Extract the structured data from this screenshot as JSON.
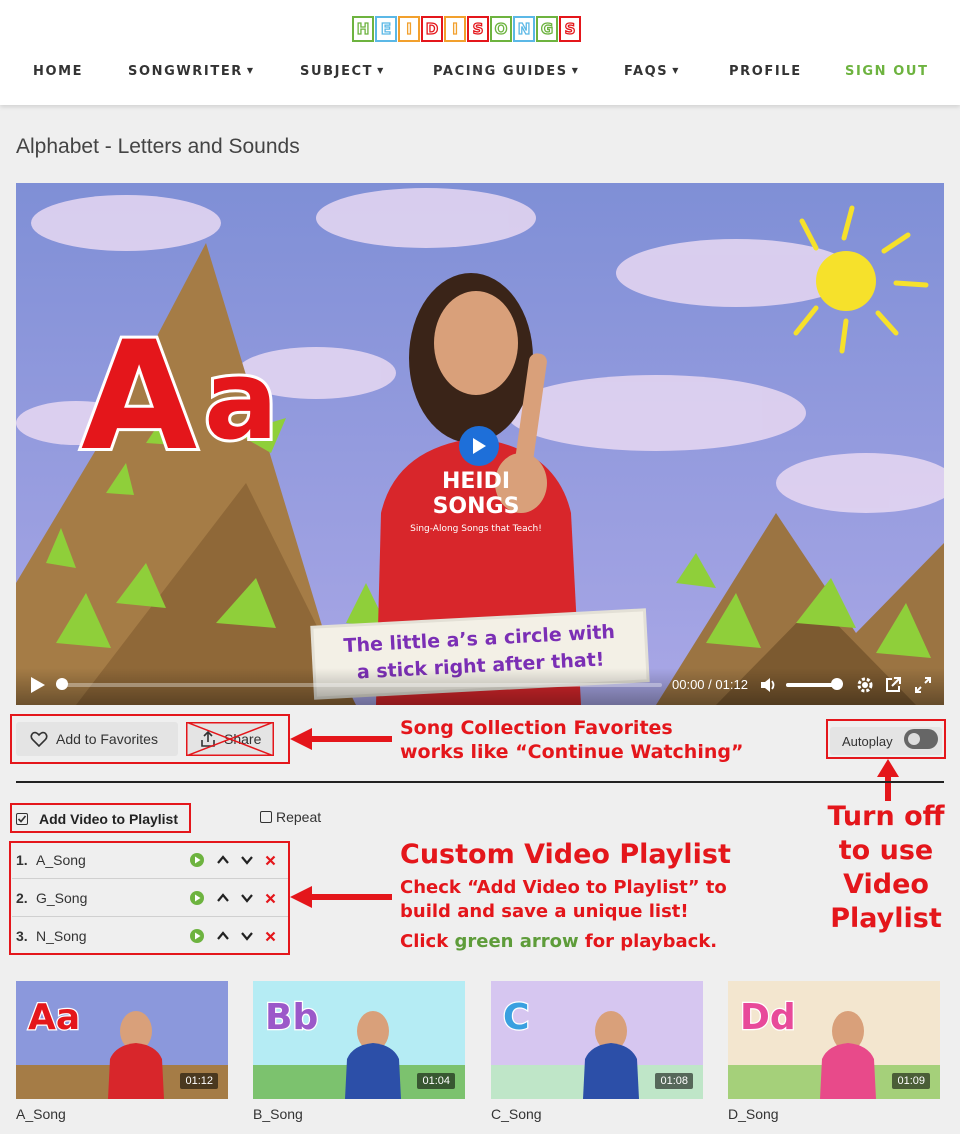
{
  "header": {
    "logo_letters": [
      "H",
      "E",
      "I",
      "D",
      "I",
      "S",
      "O",
      "N",
      "G",
      "S"
    ],
    "logo_colors": [
      "#6db33f",
      "#5bb8e6",
      "#f2a02d",
      "#e4161b",
      "#f2a02d",
      "#e4161b",
      "#6db33f",
      "#5bb8e6",
      "#6db33f",
      "#e4161b"
    ],
    "nav": [
      {
        "label": "HOME",
        "caret": ""
      },
      {
        "label": "SONGWRITER",
        "caret": "▼"
      },
      {
        "label": "SUBJECT",
        "caret": "▼"
      },
      {
        "label": "PACING GUIDES",
        "caret": "▼"
      },
      {
        "label": "FAQS",
        "caret": "▼"
      },
      {
        "label": "PROFILE",
        "caret": ""
      },
      {
        "label": "SIGN OUT",
        "caret": ""
      }
    ]
  },
  "page": {
    "title": "Alphabet - Letters and Sounds"
  },
  "video": {
    "big_letters": "Aa",
    "caption_line1": "The little a’s a circle with",
    "caption_line2": "a stick right after that!",
    "shirt_text1": "HEIDI",
    "shirt_text2": "SONGS",
    "shirt_tagline": "Sing-Along Songs that Teach!",
    "time_current": "00:00",
    "time_separator": "/",
    "time_total": "01:12",
    "progress": 0,
    "volume": 1.0
  },
  "actions": {
    "favorites_label": "Add to Favorites",
    "share_label": "Share",
    "autoplay_label": "Autoplay",
    "autoplay_on": false
  },
  "annotations": {
    "favorites_line1": "Song Collection Favorites",
    "favorites_line2": "works like “Continue Watching”",
    "autoplay_line1": "Turn off",
    "autoplay_line2": "to use",
    "autoplay_line3": "Video",
    "autoplay_line4": "Playlist",
    "playlist_title": "Custom Video Playlist",
    "playlist_line1": "Check “Add Video to Playlist” to",
    "playlist_line2": "build and save a unique list!",
    "playlist_line3_a": "Click ",
    "playlist_line3_b": "green arrow",
    "playlist_line3_c": " for playback.",
    "red": "#e4161b",
    "green": "#5e9c3a"
  },
  "playlist": {
    "add_label": "Add Video to Playlist",
    "add_checked": true,
    "repeat_label": "Repeat",
    "repeat_checked": false,
    "items": [
      {
        "num": "1.",
        "name": "A_Song"
      },
      {
        "num": "2.",
        "name": "G_Song"
      },
      {
        "num": "3.",
        "name": "N_Song"
      }
    ]
  },
  "thumbnails": [
    {
      "label": "A_Song",
      "duration": "01:12",
      "letters": "Aa",
      "shirt": "#d8262b",
      "letter_color": "#e4161b"
    },
    {
      "label": "B_Song",
      "duration": "01:04",
      "letters": "Bb",
      "shirt": "#2c4fa8",
      "letter_color": "#9b59c9"
    },
    {
      "label": "C_Song",
      "duration": "01:08",
      "letters": "C",
      "shirt": "#2c4fa8",
      "letter_color": "#3aa0e0"
    },
    {
      "label": "D_Song",
      "duration": "01:09",
      "letters": "Dd",
      "shirt": "#e84a8a",
      "letter_color": "#e84a9a"
    }
  ],
  "colors": {
    "accent_green": "#6db33f",
    "annotation_red": "#e4161b",
    "play_blue": "#1e6fd9"
  }
}
